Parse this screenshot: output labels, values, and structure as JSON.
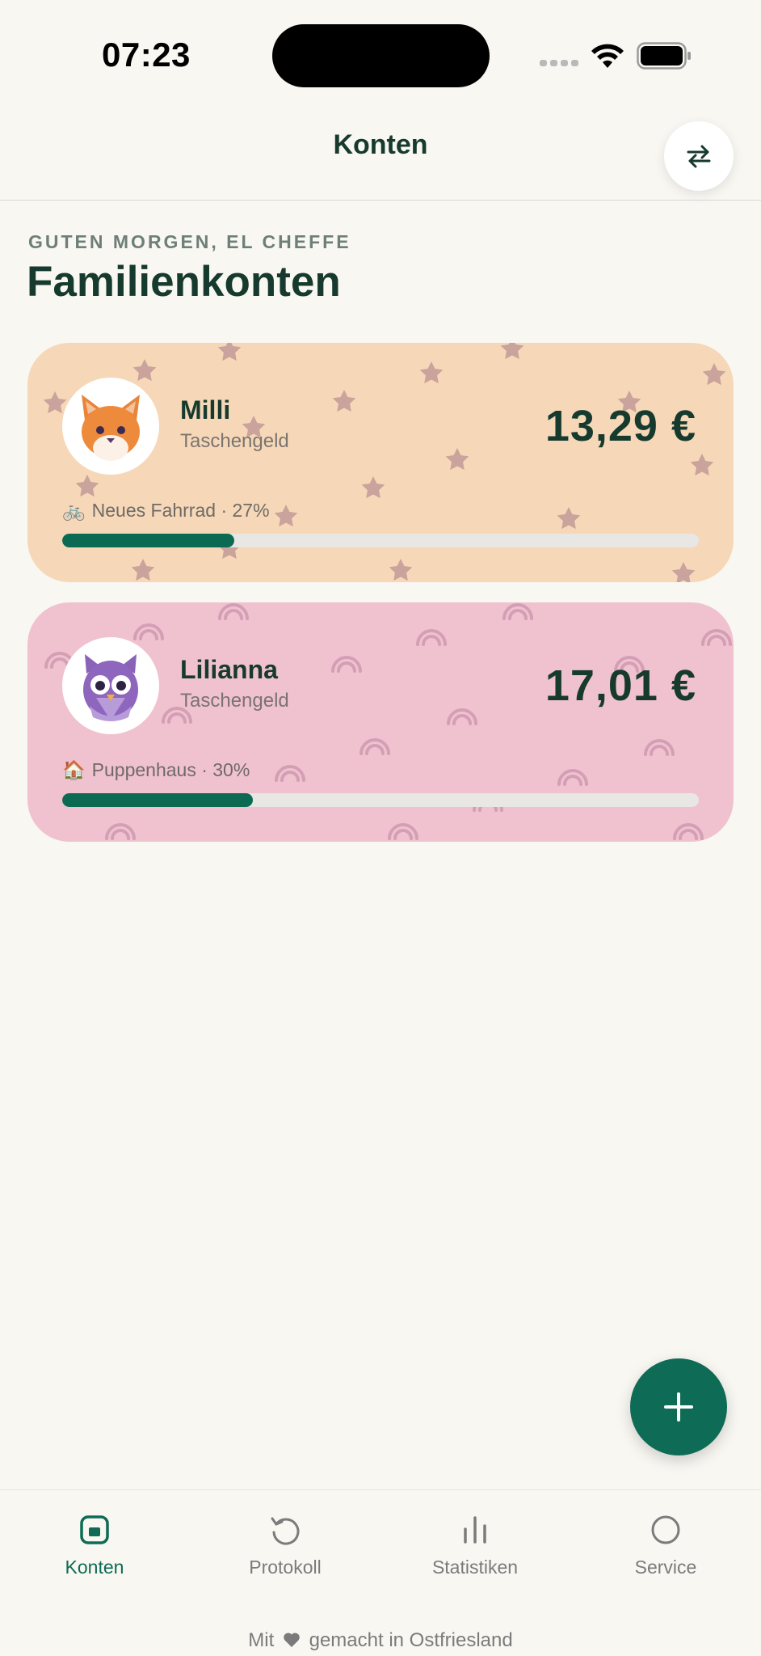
{
  "status_bar": {
    "time": "07:23"
  },
  "header": {
    "title": "Konten",
    "swap_icon": "swap-arrows-icon"
  },
  "greeting": "GUTEN MORGEN, EL CHEFFE",
  "page_title": "Familienkonten",
  "accounts": [
    {
      "name": "Milli",
      "type": "Taschengeld",
      "balance": "13,29 €",
      "avatar": "cat-avatar",
      "goal_icon": "🚲",
      "goal": "Neues Fahrrad · 27%",
      "progress": 0.27,
      "card_color": "#f6d8b8",
      "pattern": "stars"
    },
    {
      "name": "Lilianna",
      "type": "Taschengeld",
      "balance": "17,01 €",
      "avatar": "owl-avatar",
      "goal_icon": "🏠",
      "goal": "Puppenhaus · 30%",
      "progress": 0.3,
      "card_color": "#f0c2d0",
      "pattern": "rainbows"
    }
  ],
  "fab_icon": "plus-icon",
  "tabs": [
    {
      "label": "Konten",
      "icon": "wallet-icon",
      "active": true
    },
    {
      "label": "Protokoll",
      "icon": "history-icon",
      "active": false
    },
    {
      "label": "Statistiken",
      "icon": "bar-chart-icon",
      "active": false
    },
    {
      "label": "Service",
      "icon": "circle-icon",
      "active": false
    }
  ],
  "footer": {
    "prefix": "Mit",
    "suffix": "gemacht in Ostfriesland"
  },
  "colors": {
    "accent": "#0e6b55",
    "text": "#173a2e",
    "background": "#f9f7f2"
  }
}
